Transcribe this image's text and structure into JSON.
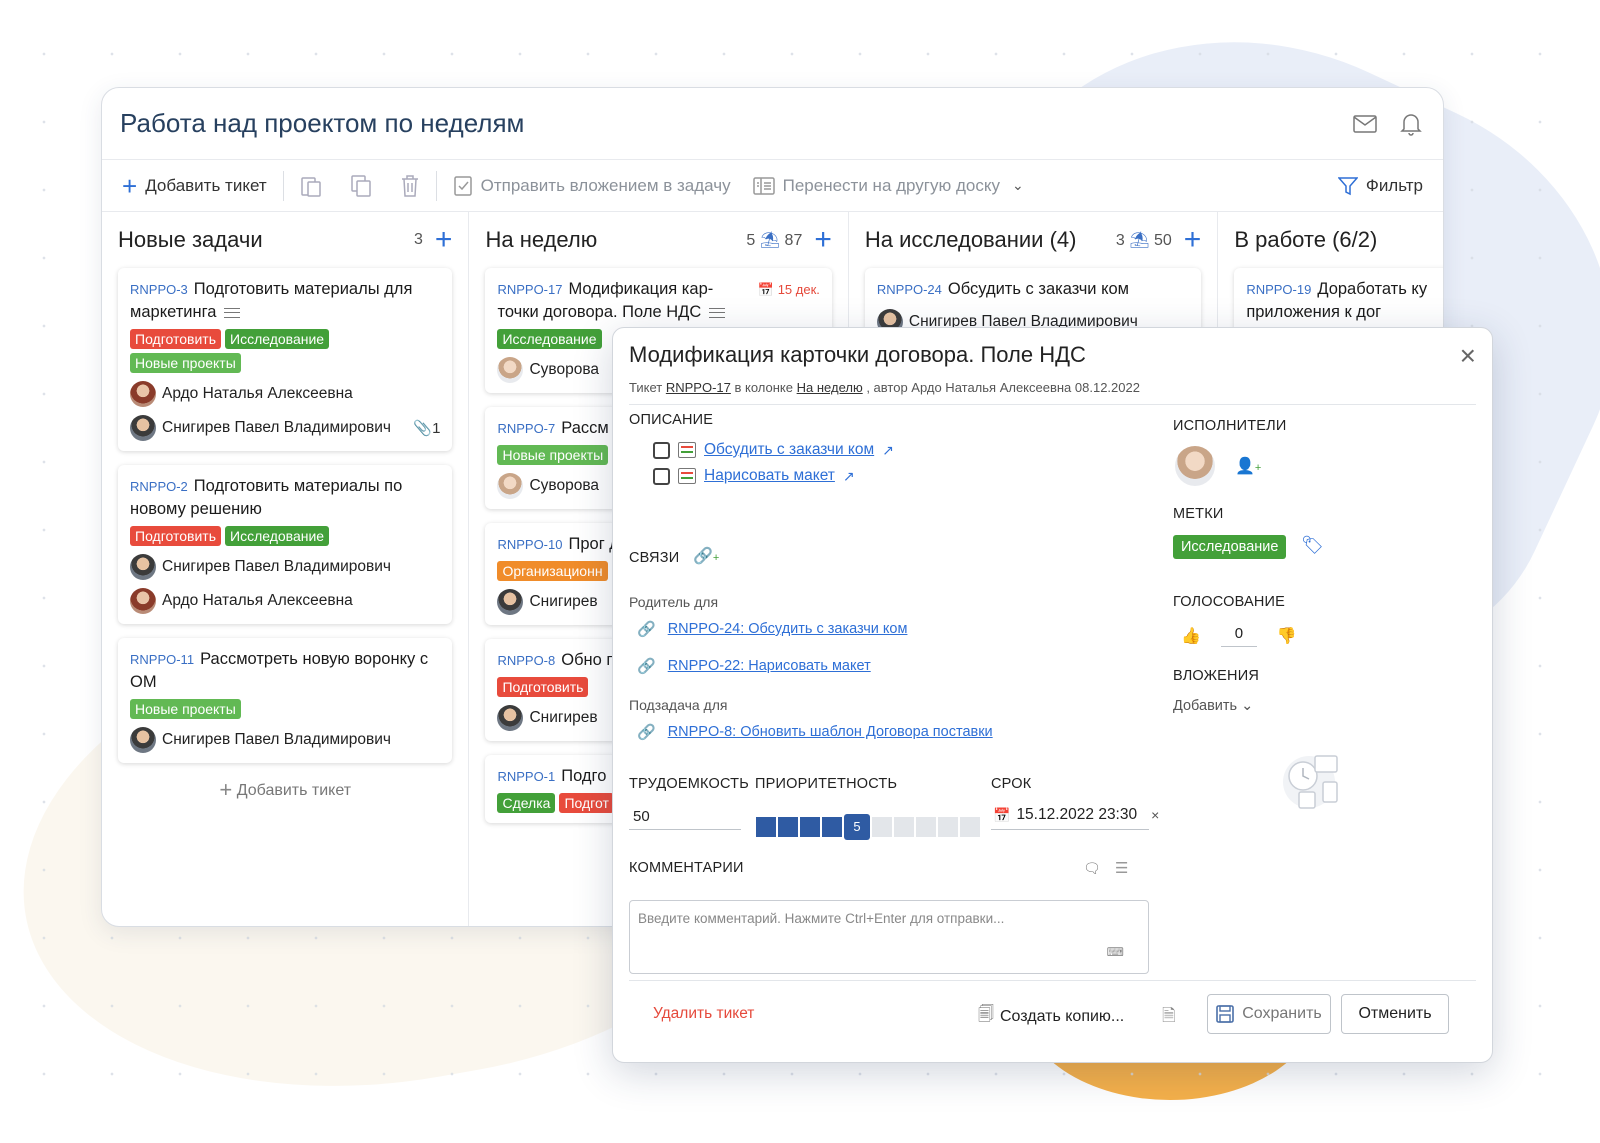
{
  "board": {
    "title": "Работа над проектом по неделям",
    "toolbar": {
      "add_ticket": "Добавить тикет",
      "send_attach": "Отправить вложением в задачу",
      "move_board": "Перенести на другую доску",
      "filter": "Фильтр"
    },
    "columns": [
      {
        "title": "Новые задачи",
        "count": "3",
        "cards": [
          {
            "key": "RNPPO-3",
            "title": "Подготовить материалы для маркетинга",
            "tags": [
              "Подготовить",
              "Исследование",
              "Новые проекты"
            ],
            "users": [
              "Ардо Наталья Алексеевна",
              "Снигирев Павел Владимирович"
            ],
            "attachments": "1"
          },
          {
            "key": "RNPPO-2",
            "title": "Подготовить материалы по новому решению",
            "tags": [
              "Подготовить",
              "Исследование"
            ],
            "users": [
              "Снигирев Павел Владимирович",
              "Ардо Наталья Алексеевна"
            ]
          },
          {
            "key": "RNPPO-11",
            "title": "Рассмотреть новую воронку с ОМ",
            "tags": [
              "Новые проекты"
            ],
            "users": [
              "Снигирев Павел Владимирович"
            ]
          }
        ],
        "add_ticket": "Добавить тикет"
      },
      {
        "title": "На неделю",
        "count": "5",
        "estimate": "87",
        "cards": [
          {
            "key": "RNPPO-17",
            "title": "Модификация кар-точки договора. Поле НДС",
            "due": "15 дек.",
            "tags": [
              "Исследование"
            ],
            "users": [
              "Суворова"
            ]
          },
          {
            "key": "RNPPO-7",
            "title": "Рассм ОМ",
            "tags": [
              "Новые проекты"
            ],
            "users": [
              "Суворова"
            ]
          },
          {
            "key": "RNPPO-10",
            "title": "Прог демонстраци",
            "tags": [
              "Организационн"
            ],
            "users": [
              "Снигирев"
            ]
          },
          {
            "key": "RNPPO-8",
            "title": "Обно поставки",
            "tags": [
              "Подготовить"
            ],
            "users": [
              "Снигирев"
            ]
          },
          {
            "key": "RNPPO-1",
            "title": "Подго",
            "tags": [
              "Сделка",
              "Подгот"
            ]
          }
        ]
      },
      {
        "title": "На исследовании (4)",
        "count": "3",
        "estimate": "50",
        "cards": [
          {
            "key": "RNPPO-24",
            "title": "Обсудить с заказчи ком",
            "users": [
              "Снигирев Павел Владимирович"
            ]
          }
        ]
      },
      {
        "title": "В работе (6/2)",
        "cards": [
          {
            "key": "RNPPO-19",
            "title": "Доработать ку приложения к дог"
          }
        ]
      }
    ]
  },
  "modal": {
    "title": "Модификация карточки договора. Поле НДС",
    "subtitle": {
      "prefix": "Тикет",
      "ticket": "RNPPO-17",
      "in_column": "в колонке",
      "column": "На неделю",
      "author": ", автор Ардо Наталья Алексеевна 08.12.2022"
    },
    "description_label": "ОПИСАНИЕ",
    "checklist": [
      "Обсудить с заказчи ком",
      "Нарисовать макет"
    ],
    "links_label": "СВЯЗИ",
    "parent_for_label": "Родитель для",
    "parent_for": [
      "RNPPO-24: Обсудить с заказчи ком",
      "RNPPO-22: Нарисовать макет"
    ],
    "subtask_for_label": "Подзадача для",
    "subtask_for": [
      "RNPPO-8: Обновить шаблон Договора поставки"
    ],
    "effort_label": "ТРУДОЕМКОСТЬ",
    "effort_value": "50",
    "priority_label": "ПРИОРИТЕТНОСТЬ",
    "priority_value": "5",
    "priority_max": 10,
    "deadline_label": "СРОК",
    "deadline_value": "15.12.2022 23:30",
    "comments_label": "КОММЕНТАРИИ",
    "comment_placeholder": "Введите комментарий. Нажмите Ctrl+Enter для отправки...",
    "assignees_label": "ИСПОЛНИТЕЛИ",
    "tags_label": "МЕТКИ",
    "tag": "Исследование",
    "voting_label": "ГОЛОСОВАНИЕ",
    "votes": "0",
    "attachments_label": "ВЛОЖЕНИЯ",
    "attach_add": "Добавить",
    "delete_ticket": "Удалить тикет",
    "create_copy": "Создать копию...",
    "save": "Сохранить",
    "cancel": "Отменить"
  }
}
